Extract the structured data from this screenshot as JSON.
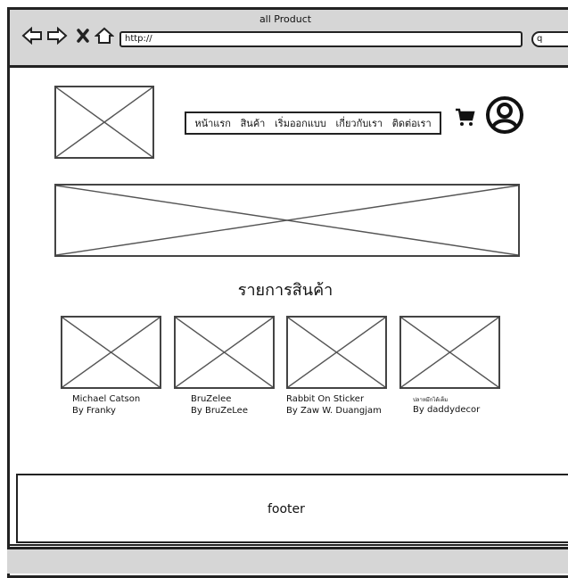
{
  "window": {
    "title": "all Product"
  },
  "toolbar": {
    "back_icon": "arrow-left-icon",
    "forward_icon": "arrow-right-icon",
    "stop_icon": "close-icon",
    "home_icon": "home-icon",
    "url": "http://",
    "search_placeholder": "q"
  },
  "header": {
    "nav": [
      "หน้าแรก",
      "สินค้า",
      "เริ่มออกแบบ",
      "เกี่ยวกับเรา",
      "ติดต่อเรา"
    ],
    "cart_icon": "cart-icon",
    "user_icon": "user-icon"
  },
  "main": {
    "section_title": "รายการสินค้า",
    "products": [
      {
        "name": "Michael Catson",
        "by": "By Franky"
      },
      {
        "name": "BruZelee",
        "by": "By BruZeLee"
      },
      {
        "name": "Rabbit On Sticker",
        "by": "By Zaw W. Duangjam"
      },
      {
        "name": "ปลาหมึกได้เต็ม",
        "by": "By daddydecor"
      }
    ]
  },
  "footer": {
    "label": "footer"
  }
}
